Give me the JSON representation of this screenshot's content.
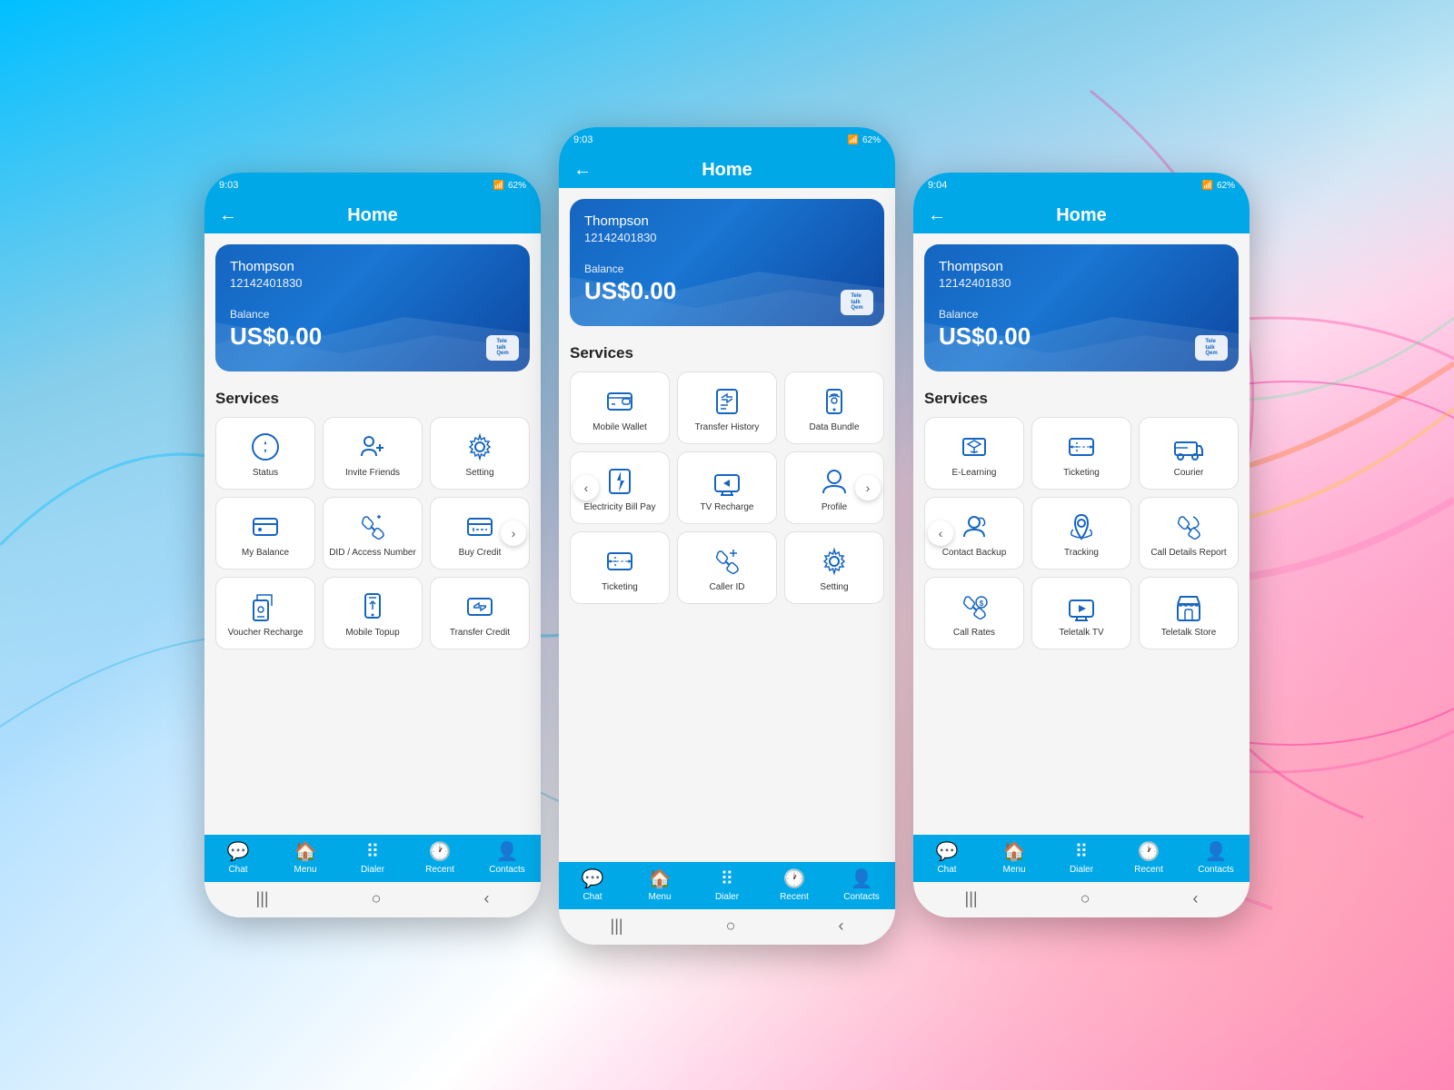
{
  "app": {
    "title": "Home",
    "back_icon": "←"
  },
  "status_bar": {
    "time": "9:03",
    "signal": "62%"
  },
  "account": {
    "name": "Thompson",
    "number": "12142401830",
    "balance_label": "Balance",
    "balance": "US$0.00"
  },
  "services_title": "Services",
  "phone_left": {
    "services": [
      {
        "id": "status",
        "label": "Status",
        "icon": "status"
      },
      {
        "id": "invite",
        "label": "Invite Friends",
        "icon": "invite"
      },
      {
        "id": "setting",
        "label": "Setting",
        "icon": "setting"
      },
      {
        "id": "my-balance",
        "label": "My Balance",
        "icon": "balance"
      },
      {
        "id": "did",
        "label": "DID / Access Number",
        "icon": "did"
      },
      {
        "id": "buy-credit",
        "label": "Buy Credit",
        "icon": "buycredit"
      },
      {
        "id": "voucher",
        "label": "Voucher Recharge",
        "icon": "voucher"
      },
      {
        "id": "mobile-topup",
        "label": "Mobile Topup",
        "icon": "mobiletopup"
      },
      {
        "id": "transfer-credit",
        "label": "Transfer Credit",
        "icon": "transfercredit"
      }
    ]
  },
  "phone_center": {
    "services": [
      {
        "id": "mobile-wallet",
        "label": "Mobile Wallet",
        "icon": "wallet"
      },
      {
        "id": "transfer-history",
        "label": "Transfer History",
        "icon": "history"
      },
      {
        "id": "data-bundle",
        "label": "Data Bundle",
        "icon": "databundle"
      },
      {
        "id": "electricity",
        "label": "Electricity Bill Pay",
        "icon": "electricity"
      },
      {
        "id": "tv-recharge",
        "label": "TV Recharge",
        "icon": "tvrecharge"
      },
      {
        "id": "profile",
        "label": "Profile",
        "icon": "profile"
      },
      {
        "id": "ticketing",
        "label": "Ticketing",
        "icon": "ticketing"
      },
      {
        "id": "caller-id",
        "label": "Caller ID",
        "icon": "callerid"
      },
      {
        "id": "setting2",
        "label": "Setting",
        "icon": "setting"
      }
    ]
  },
  "phone_right": {
    "services": [
      {
        "id": "elearning",
        "label": "E-Learning",
        "icon": "elearning"
      },
      {
        "id": "ticketing2",
        "label": "Ticketing",
        "icon": "ticketing"
      },
      {
        "id": "courier",
        "label": "Courier",
        "icon": "courier"
      },
      {
        "id": "contact-backup",
        "label": "Contact Backup",
        "icon": "contactbackup"
      },
      {
        "id": "tracking",
        "label": "Tracking",
        "icon": "tracking"
      },
      {
        "id": "cdr",
        "label": "Call Details Report",
        "icon": "cdr"
      },
      {
        "id": "call-rates",
        "label": "Call Rates",
        "icon": "callrates"
      },
      {
        "id": "teletalk-tv",
        "label": "Teletalk TV",
        "icon": "teletalk-tv"
      },
      {
        "id": "teletalk-store",
        "label": "Teletalk Store",
        "icon": "store"
      }
    ]
  },
  "nav": {
    "items": [
      {
        "id": "chat",
        "label": "Chat",
        "icon": "chat"
      },
      {
        "id": "menu",
        "label": "Menu",
        "icon": "menu"
      },
      {
        "id": "dialer",
        "label": "Dialer",
        "icon": "dialer"
      },
      {
        "id": "recent",
        "label": "Recent",
        "icon": "recent"
      },
      {
        "id": "contacts",
        "label": "Contacts",
        "icon": "contacts"
      }
    ]
  }
}
